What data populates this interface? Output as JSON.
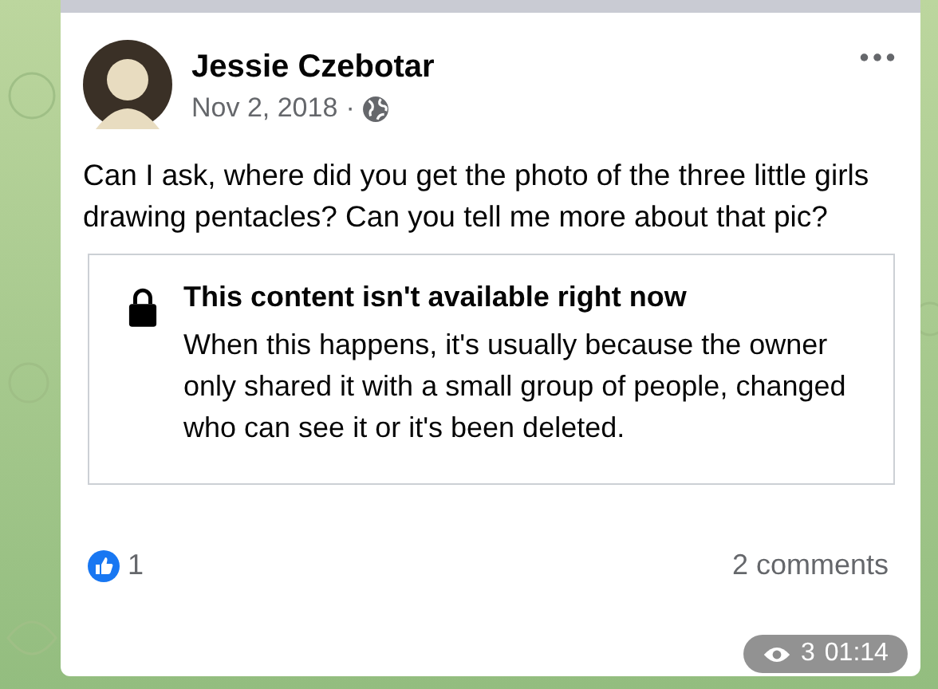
{
  "post": {
    "author": "Jessie Czebotar",
    "date": "Nov 2, 2018",
    "separator": "·",
    "text": "Can I ask, where did you get the photo of the three little girls drawing pentacles?  Can you tell me more about that pic?",
    "unavailable": {
      "title": "This content isn't available right now",
      "message": "When this happens, it's usually because the owner only shared it with a small group of people, changed who can see it or it's been deleted."
    },
    "reactions": "1",
    "comments": "2 comments"
  },
  "overlay": {
    "views": "3",
    "duration": "01:14"
  }
}
